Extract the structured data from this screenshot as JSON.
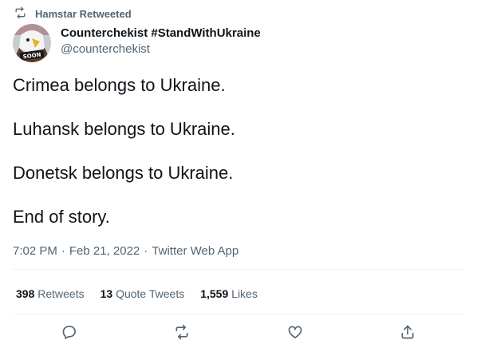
{
  "social_context": {
    "text": "Hamstar Retweeted",
    "icon": "retweet-icon"
  },
  "author": {
    "display_name": "Counterchekist #StandWithUkraine",
    "handle": "@counterchekist",
    "avatar_label": "SOON"
  },
  "tweet": {
    "lines": [
      "Crimea belongs to Ukraine.",
      "Luhansk belongs to Ukraine.",
      "Donetsk belongs to Ukraine.",
      "End of story."
    ]
  },
  "meta": {
    "time": "7:02 PM",
    "date": "Feb 21, 2022",
    "source": "Twitter Web App",
    "separator": "·"
  },
  "stats": {
    "retweets_count": "398",
    "retweets_label": "Retweets",
    "quotes_count": "13",
    "quotes_label": "Quote Tweets",
    "likes_count": "1,559",
    "likes_label": "Likes"
  },
  "actions": [
    "reply-icon",
    "retweet-icon",
    "like-icon",
    "share-icon"
  ],
  "colors": {
    "text_primary": "#0f1419",
    "text_secondary": "#536471",
    "divider": "#eff3f4"
  }
}
